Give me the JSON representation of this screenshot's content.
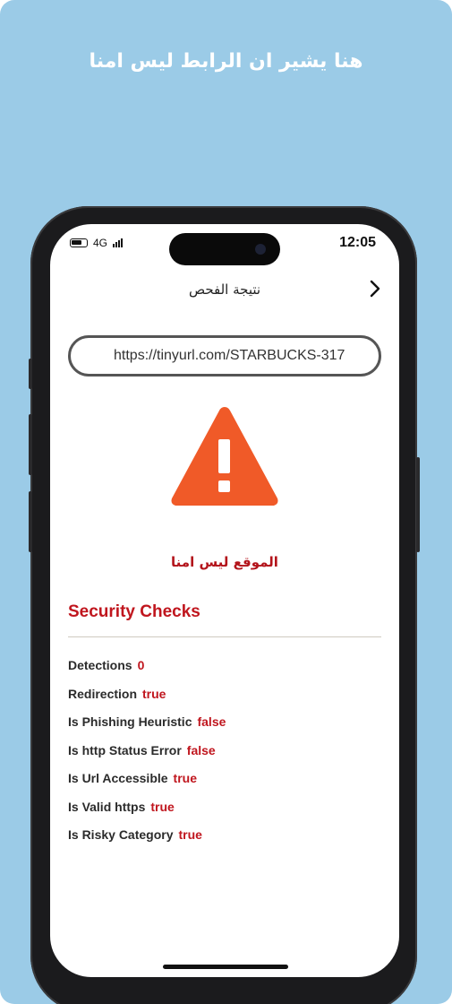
{
  "banner": {
    "text": "هنا يشير ان الرابط ليس امنا"
  },
  "status_bar": {
    "network": "4G",
    "time": "12:05"
  },
  "header": {
    "title": "نتيجة الفحص"
  },
  "url_field": {
    "value": "https://tinyurl.com/STARBUCKS-317"
  },
  "result": {
    "message": "الموقع ليس امنا"
  },
  "security": {
    "title": "Security Checks",
    "checks": [
      {
        "label": "Detections",
        "value": "0"
      },
      {
        "label": "Redirection",
        "value": "true"
      },
      {
        "label": "Is Phishing Heuristic",
        "value": "false"
      },
      {
        "label": "Is http Status Error",
        "value": "false"
      },
      {
        "label": "Is Url Accessible",
        "value": "true"
      },
      {
        "label": "Is Valid https",
        "value": "true"
      },
      {
        "label": "Is Risky Category",
        "value": "true"
      }
    ]
  },
  "colors": {
    "background": "#9bcbe7",
    "warning": "#f05a28",
    "accent_red": "#c0161e"
  },
  "icons": {
    "back": "chevron-right-icon",
    "warning": "warning-triangle-icon"
  }
}
